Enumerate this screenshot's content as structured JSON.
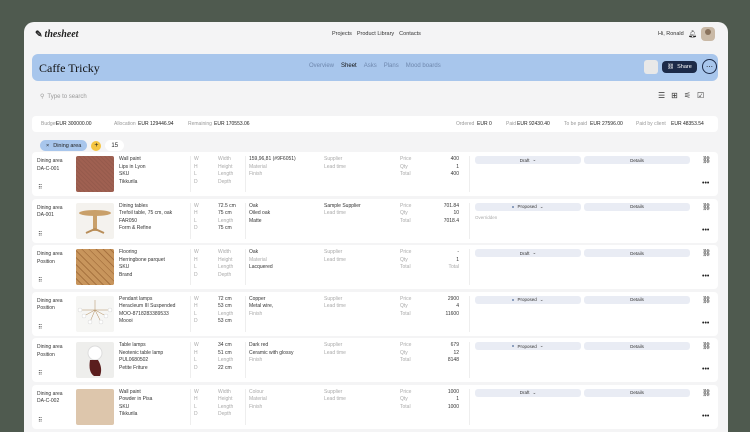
{
  "nav": {
    "logo": "thesheet",
    "links": [
      "Projects",
      "Product Library",
      "Contacts"
    ],
    "greeting": "Hi, Ronald"
  },
  "project": {
    "title": "Caffe Tricky",
    "tabs": [
      "Overview",
      "Sheet",
      "Asks",
      "Plans",
      "Mood boards"
    ],
    "active_tab": "Sheet",
    "share_label": "Share"
  },
  "search": {
    "placeholder": "Type to search"
  },
  "budget": {
    "budget_label": "Budget",
    "budget_value": "EUR 300000.00",
    "allocation_label": "Allocation",
    "allocation_value": "EUR 129446.94",
    "remaining_label": "Remaining",
    "remaining_value": "EUR 170553.06",
    "ordered_label": "Ordered",
    "ordered_value": "EUR 0",
    "paid_label": "Paid",
    "paid_value": "EUR 92430.40",
    "tobepaid_label": "To be paid",
    "tobepaid_value": "EUR 27596.00",
    "client_label": "Paid by client",
    "client_value": "EUR 48353.54"
  },
  "filter": {
    "chip": "Dining area",
    "count": "15"
  },
  "dim_letters": [
    "W",
    "H",
    "L",
    "D"
  ],
  "dim_labels": [
    "Width",
    "Height",
    "Length",
    "Depth"
  ],
  "mat_labels": [
    "Colour",
    "Material",
    "Finish"
  ],
  "sup_labels": [
    "Supplier",
    "Lead time"
  ],
  "price_labels": [
    "Price",
    "Qty",
    "Total"
  ],
  "details_label": "Details",
  "rows": [
    {
      "area": "Dining area",
      "code": "DA-C-001",
      "name": "Wall paint",
      "product": "Lips in Lyon",
      "sku": "SKU",
      "brand": "Tikkurila",
      "dims": [
        "Width",
        "Height",
        "Length",
        "Depth"
      ],
      "dims_muted": [
        true,
        true,
        true,
        true
      ],
      "mats": [
        "159,96,81 (#9F6051)",
        "Material",
        "Finish"
      ],
      "mats_muted": [
        false,
        true,
        true
      ],
      "sup": [
        "Supplier",
        "Lead time"
      ],
      "sup_muted": [
        true,
        true
      ],
      "price": [
        "400",
        "1",
        "400"
      ],
      "status": "Draft",
      "note": "",
      "thumb": "paint-terracotta"
    },
    {
      "area": "Dining area",
      "code": "DA-001",
      "name": "Dining tables",
      "product": "Trefoil table, 75 cm, oak",
      "sku": "FAR050",
      "brand": "Form & Refine",
      "dims": [
        "72.5 cm",
        "75 cm",
        "Length",
        "75 cm"
      ],
      "dims_muted": [
        false,
        false,
        true,
        false
      ],
      "mats": [
        "Oak",
        "Oiled oak",
        "Matte"
      ],
      "mats_muted": [
        false,
        false,
        false
      ],
      "sup": [
        "Sample Supplier",
        "Lead time"
      ],
      "sup_muted": [
        false,
        true
      ],
      "price": [
        "701.84",
        "10",
        "7018.4"
      ],
      "status": "Proposed",
      "note": "Overridden",
      "thumb": "table-oak"
    },
    {
      "area": "Dining area",
      "code": "Position",
      "name": "Flooring",
      "product": "Herringbone parquet",
      "sku": "SKU",
      "brand": "Brand",
      "dims": [
        "Width",
        "Height",
        "Length",
        "Depth"
      ],
      "dims_muted": [
        true,
        true,
        true,
        true
      ],
      "mats": [
        "Oak",
        "Material",
        "Lacquered"
      ],
      "mats_muted": [
        false,
        true,
        false
      ],
      "sup": [
        "Supplier",
        "Lead time"
      ],
      "sup_muted": [
        true,
        true
      ],
      "price": [
        "-",
        "1",
        "Total"
      ],
      "status": "Draft",
      "note": "",
      "thumb": "parquet"
    },
    {
      "area": "Dining area",
      "code": "Position",
      "name": "Pendant lamps",
      "product": "Heracleum III Suspended",
      "sku": "MOO-8718283389533",
      "brand": "Moooi",
      "dims": [
        "72 cm",
        "53 cm",
        "Length",
        "53 cm"
      ],
      "dims_muted": [
        false,
        false,
        true,
        false
      ],
      "mats": [
        "Copper",
        "Metal wire,",
        "Finish"
      ],
      "mats_muted": [
        false,
        false,
        true
      ],
      "sup": [
        "Supplier",
        "Lead time"
      ],
      "sup_muted": [
        true,
        true
      ],
      "price": [
        "2900",
        "4",
        "11600"
      ],
      "status": "Proposed",
      "note": "",
      "thumb": "pendant"
    },
    {
      "area": "Dining area",
      "code": "Position",
      "name": "Table lamps",
      "product": "Neotenic table lamp",
      "sku": "PUL0680502",
      "brand": "Petite Friture",
      "dims": [
        "34 cm",
        "51 cm",
        "Length",
        "22 cm"
      ],
      "dims_muted": [
        false,
        false,
        true,
        false
      ],
      "mats": [
        "Dark red",
        "Ceramic with glossy",
        "Finish"
      ],
      "mats_muted": [
        false,
        false,
        true
      ],
      "sup": [
        "Supplier",
        "Lead time"
      ],
      "sup_muted": [
        true,
        true
      ],
      "price": [
        "679",
        "12",
        "8148"
      ],
      "status": "Proposed",
      "note": "",
      "thumb": "table-lamp"
    },
    {
      "area": "Dining area",
      "code": "DA-C-002",
      "name": "Wall paint",
      "product": "Powder in Pisa",
      "sku": "SKU",
      "brand": "Tikkurila",
      "dims": [
        "Width",
        "Height",
        "Length",
        "Depth"
      ],
      "dims_muted": [
        true,
        true,
        true,
        true
      ],
      "mats": [
        "Colour",
        "Material",
        "Finish"
      ],
      "mats_muted": [
        true,
        true,
        true
      ],
      "sup": [
        "Supplier",
        "Lead time"
      ],
      "sup_muted": [
        true,
        true
      ],
      "price": [
        "1000",
        "1",
        "1000"
      ],
      "status": "Draft",
      "note": "",
      "thumb": "paint-beige"
    }
  ],
  "colors": {
    "banner": "#a8c6ec",
    "share": "#1c2a48",
    "chip_add": "#f5c542",
    "terracotta": "#9F6051"
  }
}
